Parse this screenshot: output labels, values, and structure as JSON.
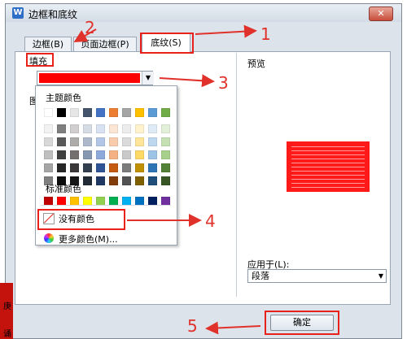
{
  "window": {
    "title": "边框和底纹",
    "app_icon_glyph": "W",
    "close_glyph": "✕"
  },
  "tabs": [
    {
      "label": "边框(B)"
    },
    {
      "label": "页面边框(P)"
    },
    {
      "label": "底纹(S)"
    }
  ],
  "fill": {
    "label": "填充",
    "selected_color": "#ff0000",
    "arrow": "▼"
  },
  "pattern": {
    "label": "图"
  },
  "palette": {
    "theme_title": "主题颜色",
    "standard_title": "标准颜色",
    "theme_top": [
      "#ffffff",
      "#000000",
      "#e7e6e6",
      "#44546a",
      "#4472c4",
      "#ed7d31",
      "#a5a5a5",
      "#ffc000",
      "#5b9bd5",
      "#70ad47"
    ],
    "theme_shades": [
      [
        "#f2f2f2",
        "#7f7f7f",
        "#d0cece",
        "#d6dce4",
        "#d9e2f3",
        "#fbe5d5",
        "#ededed",
        "#fff2cc",
        "#deebf6",
        "#e2efd9"
      ],
      [
        "#d8d8d8",
        "#595959",
        "#aeabab",
        "#adb9ca",
        "#b4c6e7",
        "#f7cbac",
        "#dbdbdb",
        "#fee599",
        "#bdd7ee",
        "#c5e0b3"
      ],
      [
        "#bfbfbf",
        "#3f3f3f",
        "#757070",
        "#8496b0",
        "#8eaadb",
        "#f4b183",
        "#c9c9c9",
        "#ffd965",
        "#9dc3e6",
        "#a8d08d"
      ],
      [
        "#a5a5a5",
        "#262626",
        "#3a3838",
        "#323f4f",
        "#2f5496",
        "#c55a11",
        "#7b7b7b",
        "#bf9000",
        "#2e75b5",
        "#538135"
      ],
      [
        "#7f7f7f",
        "#0c0c0c",
        "#171616",
        "#222a35",
        "#1f3864",
        "#833c0b",
        "#525252",
        "#7f6000",
        "#1e4e79",
        "#375623"
      ]
    ],
    "standard": [
      "#c00000",
      "#ff0000",
      "#ffc000",
      "#ffff00",
      "#92d050",
      "#00b050",
      "#00b0f0",
      "#0070c0",
      "#002060",
      "#7030a0"
    ],
    "no_color_label": "没有颜色",
    "more_colors_label": "更多颜色(M)..."
  },
  "preview": {
    "label": "预览",
    "fill_color": "#ff1a1a"
  },
  "apply_to": {
    "label": "应用于(L):",
    "value": "段落",
    "arrow": "▼"
  },
  "buttons": {
    "ok": "确定"
  },
  "annotations": [
    "1",
    "2",
    "3",
    "4",
    "5"
  ],
  "accent_color": "#e8221b",
  "left_fragment": [
    "庚",
    "诵"
  ]
}
